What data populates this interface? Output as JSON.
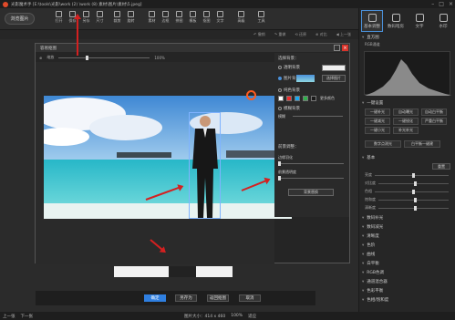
{
  "titlebar": {
    "title": "光影魔术手 [E:\\tools\\光影\\work (2) \\work (8) 素材\\图片\\素材\\5.jpeg]",
    "controls": [
      "–",
      "□",
      "×"
    ]
  },
  "toolbar": {
    "browse": "浏览图片",
    "items": [
      "打开",
      "保存",
      "另存",
      "尺寸",
      "裁剪",
      "旋转",
      "素材",
      "边框",
      "拼图",
      "模板",
      "抠图",
      "文字",
      "高级",
      "工具"
    ]
  },
  "subtool": {
    "items": [
      "↶ 撤销",
      "↷ 重做",
      "⟲ 还原",
      "⊕ 对比",
      "◀ 上一张"
    ]
  },
  "dialog": {
    "title": "容易抠图",
    "zoom_label": "缩放",
    "zoom_value": "100%",
    "buttons": [
      "确定",
      "另存为",
      "返回抠图",
      "取消"
    ]
  },
  "options": {
    "heading": "选择背景：",
    "opt1": "透明背景",
    "opt2": "图片背景",
    "choose_bg": "选择图片",
    "opt3": "纯色背景",
    "more_color": "更多颜色",
    "opt4": "模糊背景",
    "blur": "模糊",
    "front": "前景调整：",
    "feather": "边缘羽化",
    "opacity": "前景透明度",
    "apply": "背景替换",
    "colors": [
      "#ffffff",
      "#ee2b2b",
      "#19a7f0",
      "#2fb14b",
      "#1a1a1a"
    ]
  },
  "rpanel": {
    "tabs": [
      "基本调整",
      "数码暗房",
      "文字",
      "水印"
    ],
    "histogram": "直方图",
    "hist_mode": "RGB通道",
    "one_key": "一键设置",
    "one_key_btns": [
      "一键补光",
      "自动曝光",
      "自动白平衡",
      "一键减光",
      "一键锐化",
      "严重白平衡",
      "一键小光",
      "补光补光"
    ],
    "btn2": [
      "数字点测光",
      "白平衡一键建"
    ],
    "basic": "基本",
    "reset": "重置",
    "sliders": [
      "亮度",
      "对比度",
      "色相",
      "饱和度",
      "清晰度"
    ],
    "list": [
      "数码补光",
      "数码减光",
      "清晰度",
      "色阶",
      "曲线",
      "白平衡",
      "RGB色调",
      "通道混合器",
      "色彩平衡",
      "色相/饱和度"
    ]
  },
  "status": {
    "prev": "上一张",
    "next": "下一张",
    "size": "图片大小：414 x 460",
    "zoom": "100%",
    "fit": "适应"
  }
}
